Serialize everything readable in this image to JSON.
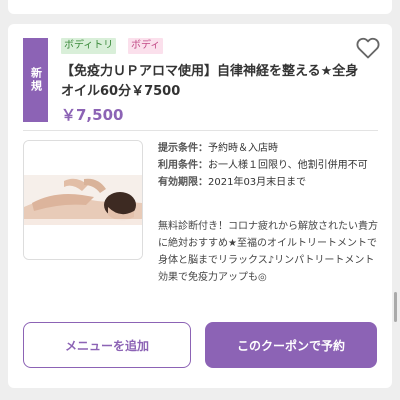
{
  "coupon": {
    "new_badge": "新規",
    "tags": [
      "ボディトリ",
      "ボディ"
    ],
    "title": "【免疫力ＵＰアロマ使用】自律神経を整える★全身オイル60分￥7500",
    "price": "￥7,500",
    "conditions": [
      {
        "key": "提示条件：",
        "value": "予約時＆入店時"
      },
      {
        "key": "利用条件：",
        "value": "お一人様１回限り、他割引併用不可"
      },
      {
        "key": "有効期限：",
        "value": "2021年03月末日まで"
      }
    ],
    "description": "無料診断付き！コロナ疲れから解放されたい貴方に絶対おすすめ★至福のオイルトリートメントで身体と脳までリラックス♪リンパトリートメント効果で免疫力アップも◎"
  },
  "buttons": {
    "add_menu": "メニューを追加",
    "reserve": "このクーポンで予約"
  },
  "colors": {
    "accent": "#8c63b5",
    "tag_green_bg": "#d9efd9",
    "tag_pink_bg": "#fbe0ec"
  },
  "icons": {
    "favorite": "heart-outline-icon"
  }
}
